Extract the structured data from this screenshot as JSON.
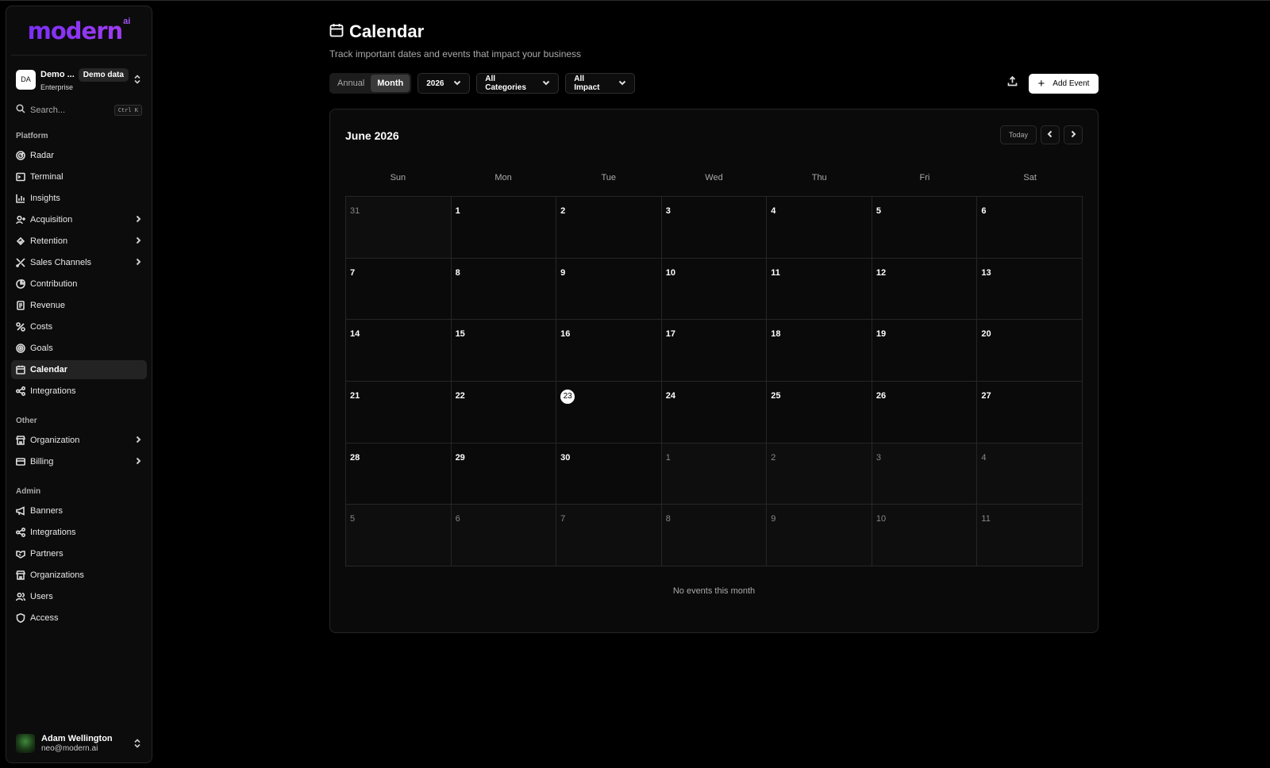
{
  "sidebar": {
    "logo": "modern",
    "logo_sup": "ai",
    "org": {
      "initials": "DA",
      "name": "Demo ...",
      "badge": "Demo data",
      "plan": "Enterprise"
    },
    "search": {
      "placeholder": "Search...",
      "shortcut": "Ctrl K"
    },
    "sections": {
      "platform": "Platform",
      "other": "Other",
      "admin": "Admin"
    },
    "platform_items": [
      {
        "label": "Radar",
        "icon": "radar-icon"
      },
      {
        "label": "Terminal",
        "icon": "terminal-icon"
      },
      {
        "label": "Insights",
        "icon": "bar-chart-icon"
      },
      {
        "label": "Acquisition",
        "icon": "user-plus-icon"
      },
      {
        "label": "Retention",
        "icon": "retention-icon"
      },
      {
        "label": "Sales Channels",
        "icon": "channels-icon"
      },
      {
        "label": "Contribution",
        "icon": "pie-chart-icon"
      },
      {
        "label": "Revenue",
        "icon": "receipt-icon"
      },
      {
        "label": "Costs",
        "icon": "costs-icon"
      },
      {
        "label": "Goals",
        "icon": "goal-icon"
      },
      {
        "label": "Calendar",
        "icon": "calendar-icon"
      },
      {
        "label": "Integrations",
        "icon": "share-icon"
      }
    ],
    "other_items": [
      {
        "label": "Organization",
        "icon": "store-icon"
      },
      {
        "label": "Billing",
        "icon": "credit-card-icon"
      }
    ],
    "admin_items": [
      {
        "label": "Banners",
        "icon": "megaphone-icon"
      },
      {
        "label": "Integrations",
        "icon": "share-icon"
      },
      {
        "label": "Partners",
        "icon": "handshake-icon"
      },
      {
        "label": "Organizations",
        "icon": "store-icon"
      },
      {
        "label": "Users",
        "icon": "users-icon"
      },
      {
        "label": "Access",
        "icon": "shield-icon"
      }
    ],
    "user": {
      "name": "Adam Wellington",
      "email": "neo@modern.ai"
    }
  },
  "header": {
    "title": "Calendar",
    "subtitle": "Track important dates and events that impact your business"
  },
  "toolbar": {
    "view_annual": "Annual",
    "view_month": "Month",
    "year": "2026",
    "categories": "All Categories",
    "impact": "All Impact",
    "add_event": "Add Event"
  },
  "calendar": {
    "month_title": "June 2026",
    "today_label": "Today",
    "weekdays": [
      "Sun",
      "Mon",
      "Tue",
      "Wed",
      "Thu",
      "Fri",
      "Sat"
    ],
    "today_day": "23",
    "weeks": [
      [
        {
          "d": "31",
          "m": true
        },
        {
          "d": "1"
        },
        {
          "d": "2"
        },
        {
          "d": "3"
        },
        {
          "d": "4"
        },
        {
          "d": "5"
        },
        {
          "d": "6"
        }
      ],
      [
        {
          "d": "7"
        },
        {
          "d": "8"
        },
        {
          "d": "9"
        },
        {
          "d": "10"
        },
        {
          "d": "11"
        },
        {
          "d": "12"
        },
        {
          "d": "13"
        }
      ],
      [
        {
          "d": "14"
        },
        {
          "d": "15"
        },
        {
          "d": "16"
        },
        {
          "d": "17"
        },
        {
          "d": "18"
        },
        {
          "d": "19"
        },
        {
          "d": "20"
        }
      ],
      [
        {
          "d": "21"
        },
        {
          "d": "22"
        },
        {
          "d": "23",
          "t": true
        },
        {
          "d": "24"
        },
        {
          "d": "25"
        },
        {
          "d": "26"
        },
        {
          "d": "27"
        }
      ],
      [
        {
          "d": "28"
        },
        {
          "d": "29"
        },
        {
          "d": "30"
        },
        {
          "d": "1",
          "m": true
        },
        {
          "d": "2",
          "m": true
        },
        {
          "d": "3",
          "m": true
        },
        {
          "d": "4",
          "m": true
        }
      ],
      [
        {
          "d": "5",
          "m": true
        },
        {
          "d": "6",
          "m": true
        },
        {
          "d": "7",
          "m": true
        },
        {
          "d": "8",
          "m": true
        },
        {
          "d": "9",
          "m": true
        },
        {
          "d": "10",
          "m": true
        },
        {
          "d": "11",
          "m": true
        }
      ]
    ],
    "empty_message": "No events this month"
  },
  "colors": {
    "brand": "#8b2df0",
    "background": "#000000",
    "card": "#0a0a0a"
  }
}
